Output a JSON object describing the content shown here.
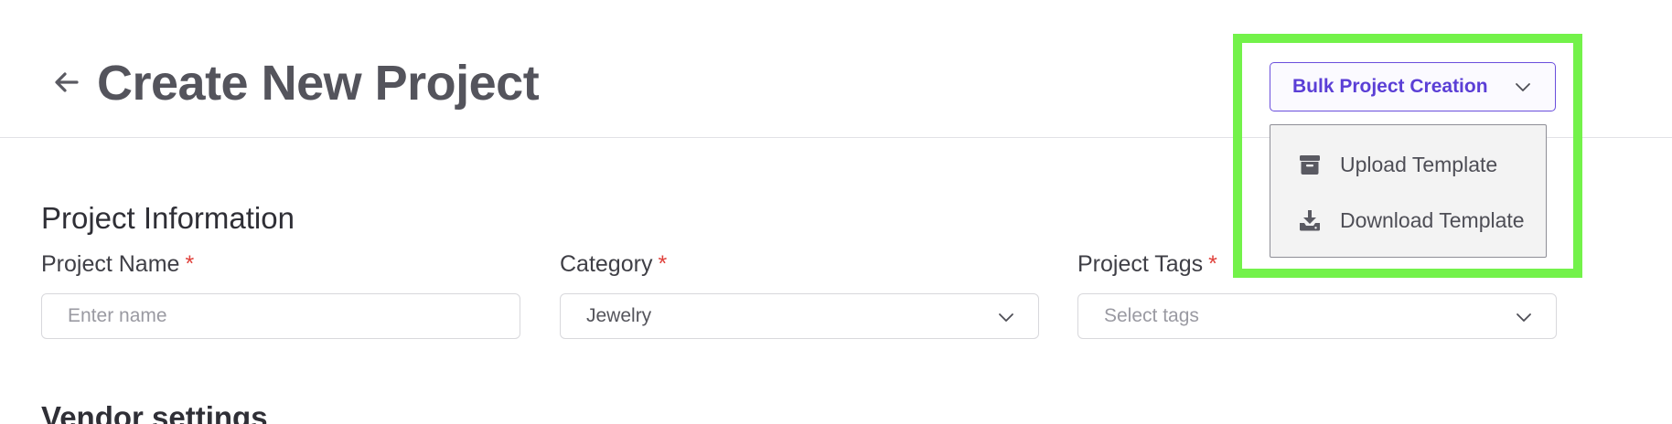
{
  "header": {
    "title": "Create New Project",
    "back_icon": "arrow-left-icon"
  },
  "bulk": {
    "button_label": "Bulk Project Creation",
    "chevron_icon": "chevron-down-icon",
    "menu": [
      {
        "label": "Upload Template",
        "icon": "archive-box-icon"
      },
      {
        "label": "Download Template",
        "icon": "download-tray-icon"
      }
    ]
  },
  "form": {
    "section_title": "Project Information",
    "fields": [
      {
        "label": "Project Name",
        "required_mark": "*",
        "placeholder": "Enter name",
        "value": ""
      },
      {
        "label": "Category",
        "required_mark": "*",
        "placeholder": "",
        "value": "Jewelry"
      },
      {
        "label": "Project Tags",
        "required_mark": "*",
        "placeholder": "Select tags",
        "value": ""
      }
    ]
  },
  "vendor": {
    "section_title": "Vendor settings"
  },
  "colors": {
    "accent": "#5b3fd6",
    "highlight": "#73f24a",
    "required": "#e0413b"
  }
}
